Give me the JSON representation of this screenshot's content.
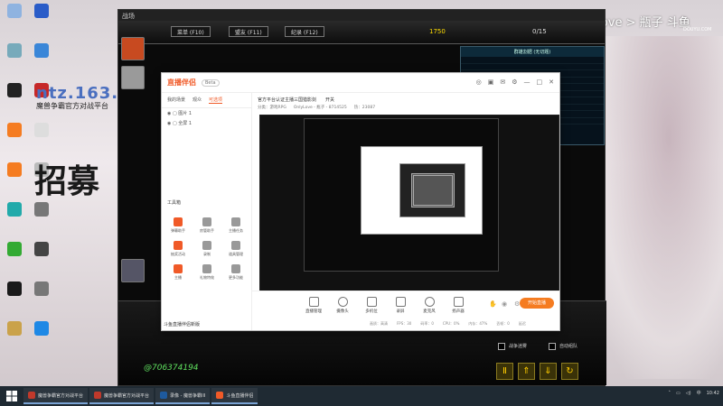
{
  "desktop": {
    "watermark": "ntz.163.com",
    "watermark_sub": "魔兽争霸官方对战平台",
    "big_text": "招募",
    "brand": "OnlyLove > 瓶子 斗鱼",
    "brand_sub": "DOUYU.COM",
    "icons": [
      {
        "label": "",
        "color": "#8fb3e0"
      },
      {
        "label": "",
        "color": "#2a5cc8"
      },
      {
        "label": "",
        "color": "#7ab"
      },
      {
        "label": "",
        "color": "#3a86d8"
      },
      {
        "label": "",
        "color": "#222"
      },
      {
        "label": "",
        "color": "#c62828"
      },
      {
        "label": "",
        "color": "#f57c21"
      },
      {
        "label": "",
        "color": "#ddd"
      },
      {
        "label": "",
        "color": "#f57c21"
      },
      {
        "label": "",
        "color": "#bbb"
      },
      {
        "label": "",
        "color": "#2aa"
      },
      {
        "label": "",
        "color": "#777"
      },
      {
        "label": "",
        "color": "#3a3"
      },
      {
        "label": "",
        "color": "#444"
      },
      {
        "label": "",
        "color": "#1a1a1a"
      },
      {
        "label": "",
        "color": "#777"
      },
      {
        "label": "",
        "color": "#caa24a"
      },
      {
        "label": "",
        "color": "#1e88e5"
      }
    ]
  },
  "game": {
    "title": "战场",
    "menu_btn": "菜单 (F10)",
    "ally_btn": "盟友 (F11)",
    "log_btn": "纪录 (F12)",
    "gold": "1750",
    "lumber": "0/15",
    "panel_title": "群雄割据 (无切题)",
    "score": "@706374194",
    "check1": "战争迷雾",
    "check2": "自动组队"
  },
  "stream": {
    "app_name": "直播伴侣",
    "badge": "Beta",
    "tabs": [
      "我的场景",
      "观众",
      "可选项"
    ],
    "scenes": [
      "图片 1",
      "全屏 1"
    ],
    "tools_title": "工具箱",
    "tools": [
      "弹幕助手",
      "房管助手",
      "主播任务",
      "抽奖活动",
      "录制",
      "道具管理",
      "主播",
      "礼物特效",
      "更多功能"
    ],
    "footer": "斗鱼直播伴侣新版",
    "room_title": "官方平台认证主播三国猎影剑",
    "tag": "开关",
    "meta": [
      "分类：游戏RPG",
      "OnlyLove - 瓶子 - 8714525",
      "热：23087"
    ],
    "bottom_buttons": [
      "直播管理",
      "摄像头",
      "多机位",
      "录屏",
      "麦克风",
      "扬声器"
    ],
    "start_live": "开始直播",
    "stats": [
      "画质：高清",
      "FPS：30",
      "码率：0",
      "CPU：0%",
      "内存：47%",
      "丢帧：0",
      "延迟"
    ]
  },
  "taskbar": {
    "items": [
      "魔兽争霸官方对战平台",
      "魔兽争霸官方对战平台",
      "录像 - 魔兽争霸III",
      "斗鱼直播伴侣"
    ],
    "time": "10:42"
  }
}
